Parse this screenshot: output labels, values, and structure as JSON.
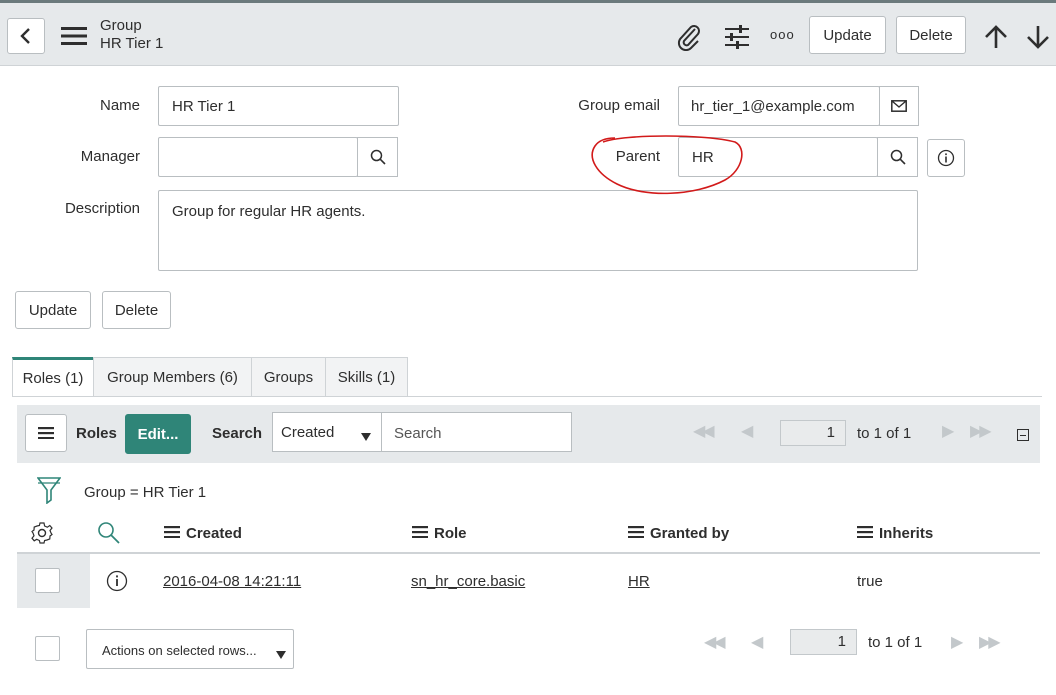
{
  "header": {
    "record_type": "Group",
    "record_name": "HR Tier 1",
    "update_label": "Update",
    "delete_label": "Delete",
    "more_label": "ooo"
  },
  "form": {
    "name_label": "Name",
    "name_value": "HR Tier 1",
    "manager_label": "Manager",
    "manager_value": "",
    "description_label": "Description",
    "description_value": "Group for regular HR agents.",
    "group_email_label": "Group email",
    "group_email_value": "hr_tier_1@example.com",
    "parent_label": "Parent",
    "parent_value": "HR",
    "update_label": "Update",
    "delete_label": "Delete"
  },
  "tabs": [
    {
      "label": "Roles (1)",
      "active": true
    },
    {
      "label": "Group Members (6)",
      "active": false
    },
    {
      "label": "Groups",
      "active": false
    },
    {
      "label": "Skills (1)",
      "active": false
    }
  ],
  "related_list": {
    "title": "Roles",
    "edit_label": "Edit...",
    "search_label": "Search",
    "search_field_selected": "Created",
    "search_placeholder": "Search",
    "page_value": "1",
    "page_range": "to 1 of 1",
    "filter_text": "Group = HR Tier 1",
    "columns": [
      "Created",
      "Role",
      "Granted by",
      "Inherits"
    ],
    "rows": [
      {
        "created": "2016-04-08 14:21:11",
        "role": "sn_hr_core.basic",
        "granted_by": "HR",
        "inherits": "true"
      }
    ],
    "actions_label": "Actions on selected rows...",
    "footer_page_value": "1",
    "footer_page_range": "to 1 of 1"
  },
  "colors": {
    "accent": "#2f8578",
    "annotation": "#d21a1a",
    "header_bg": "#e6e9eb"
  }
}
